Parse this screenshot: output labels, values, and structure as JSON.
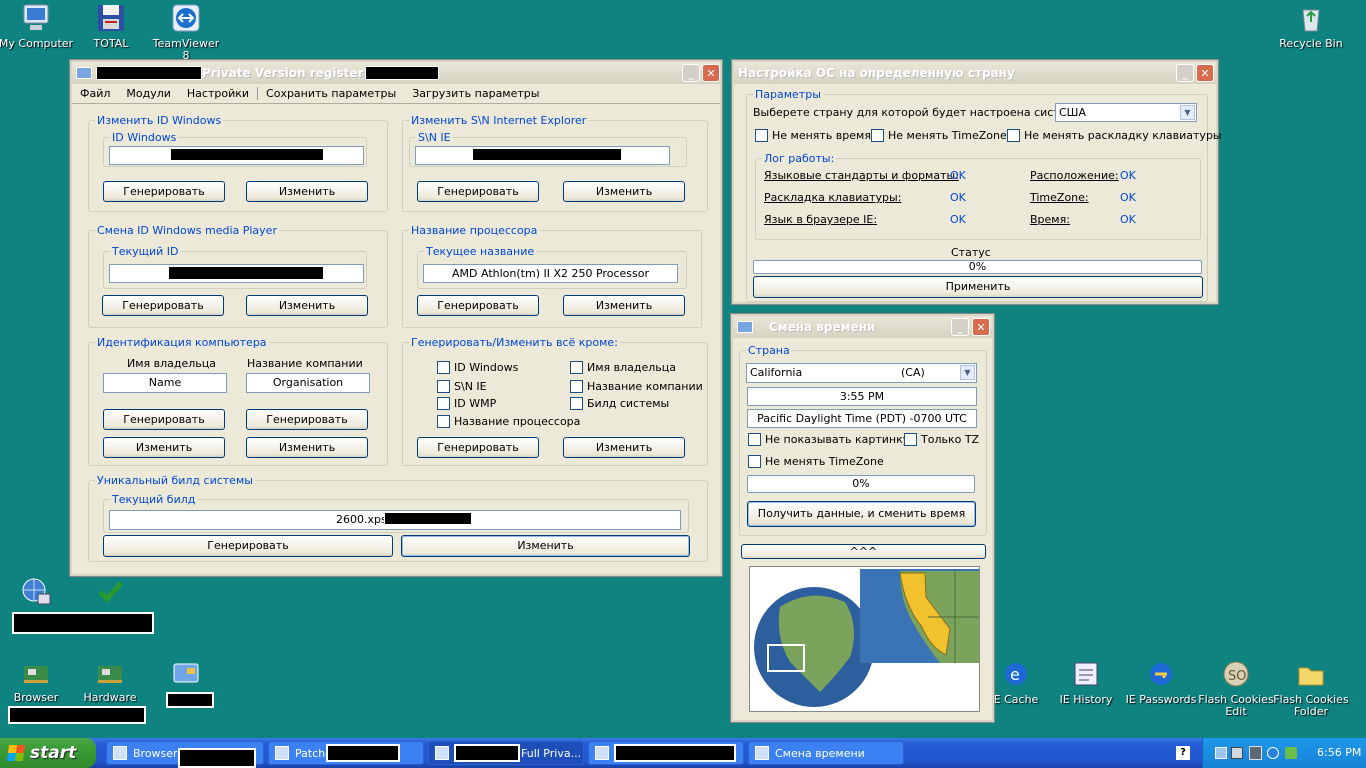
{
  "desktop": {
    "icons": {
      "my_computer": "My Computer",
      "total": "TOTAL",
      "teamviewer": "TeamViewer 8",
      "recycle_bin": "Recycle Bin",
      "browser": "Browser",
      "hardware": "Hardware",
      "ie_cache": "E Cache",
      "ie_history": "IE History",
      "ie_passwords": "IE Passwords",
      "flash_cookies_edit": "Flash Cookies Edit",
      "flash_cookies_folder": "Flash Cookies Folder"
    }
  },
  "main_window": {
    "title": "Private Version register",
    "menu": [
      "Файл",
      "Модули",
      "Настройки",
      "Сохранить параметры",
      "Загрузить параметры"
    ],
    "grp_windows_id": {
      "label": "Изменить ID Windows",
      "sub": "ID Windows"
    },
    "grp_ie_sn": {
      "label": "Изменить S\\N Internet Explorer",
      "sub": "S\\N IE"
    },
    "grp_wmp": {
      "label": "Смена ID Windows media Player",
      "sub": "Текущий ID"
    },
    "grp_cpu": {
      "label": "Название процессора",
      "sub": "Текущее название",
      "value": "AMD Athlon(tm) II X2 250 Processor"
    },
    "grp_ident": {
      "label": "Идентификация компьютера",
      "owner_label": "Имя владельца",
      "company_label": "Название компании",
      "owner_value": "Name",
      "company_value": "Organisation"
    },
    "grp_all_except": {
      "label": "Генерировать/Изменить всё кроме:",
      "checks": [
        "ID Windows",
        "S\\N IE",
        "ID WMP",
        "Название процессора",
        "Имя владельца",
        "Название компании",
        "Билд системы"
      ]
    },
    "grp_build": {
      "label": "Уникальный билд системы",
      "sub": "Текущий билд",
      "value": "2600.xpsp"
    },
    "btn_generate": "Генерировать",
    "btn_change": "Изменить"
  },
  "os_window": {
    "title": "Настройка ОС на определенную страну",
    "params_label": "Параметры",
    "country_prompt": "Выберете страну для которой будет настроена система:",
    "country_value": "США",
    "checks": [
      "Не менять время",
      "Не менять TimeZone",
      "Не менять раскладку клавиатуры"
    ],
    "log_label": "Лог работы:",
    "log": [
      {
        "name": "Языковые стандарты и форматы:",
        "status": "OK"
      },
      {
        "name": "Раскладка клавиатуры:",
        "status": "OK"
      },
      {
        "name": "Язык в браузере IE:",
        "status": "OK"
      },
      {
        "name": "Расположение:",
        "status": "OK"
      },
      {
        "name": "TimeZone:",
        "status": "OK"
      },
      {
        "name": "Время:",
        "status": "OK"
      }
    ],
    "status_label": "Статус",
    "progress_text": "0%",
    "progress_value": 0,
    "apply_button": "Применить"
  },
  "time_window": {
    "title": "Смена времени",
    "country_label": "Страна",
    "region": "California",
    "region_code": "(CA)",
    "time": "3:55 PM",
    "timezone": "Pacific Daylight Time (PDT) -0700 UTC",
    "checks": [
      "Не показывать картинку",
      "Только TZ",
      "Не менять TimeZone"
    ],
    "progress_text": "0%",
    "progress_value": 0,
    "apply_button": "Получить данные, и сменить время",
    "collapse_button": "^^^"
  },
  "taskbar": {
    "start": "start",
    "tasks": [
      "Browser",
      "Patch",
      "Full Priva...",
      "",
      "Смена времени"
    ],
    "clock": "6:56 PM",
    "help": "?"
  },
  "colors": {
    "desktop": "#0e8380",
    "taskbar": "#2155cc",
    "start": "#3c9e37",
    "accent_link": "#0046d5"
  }
}
